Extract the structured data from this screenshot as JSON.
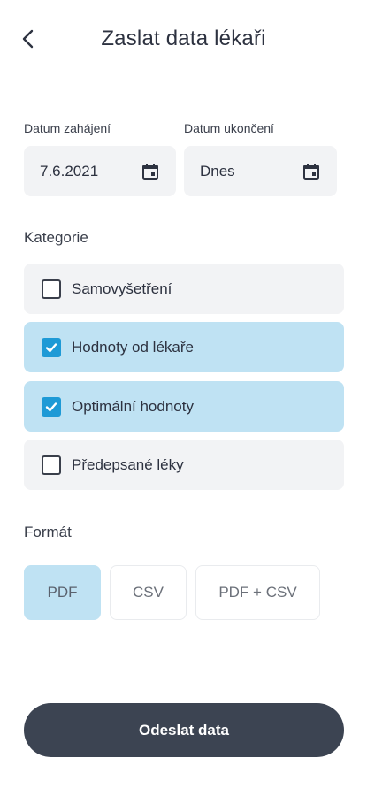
{
  "header": {
    "title": "Zaslat data lékaři",
    "back_icon": "chevron-left-icon"
  },
  "dates": {
    "start_label": "Datum zahájení",
    "start_value": "7.6.2021",
    "end_label": "Datum ukončení",
    "end_value": "Dnes",
    "calendar_icon": "calendar-icon"
  },
  "categories": {
    "label": "Kategorie",
    "items": [
      {
        "label": "Samovyšetření",
        "checked": false
      },
      {
        "label": "Hodnoty od lékaře",
        "checked": true
      },
      {
        "label": "Optimální hodnoty",
        "checked": true
      },
      {
        "label": "Předepsané léky",
        "checked": false
      }
    ]
  },
  "format": {
    "label": "Formát",
    "options": [
      {
        "label": "PDF",
        "selected": true
      },
      {
        "label": "CSV",
        "selected": false
      },
      {
        "label": "PDF + CSV",
        "selected": false
      }
    ]
  },
  "submit_label": "Odeslat data",
  "colors": {
    "accent": "#1e9ad6",
    "selected_bg": "#bfe2f3",
    "button_bg": "#3c4452"
  }
}
